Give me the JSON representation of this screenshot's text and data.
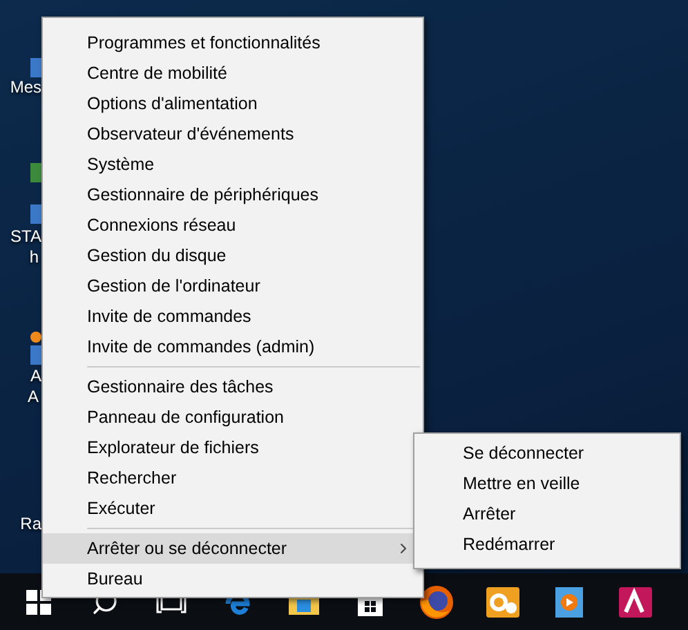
{
  "desktop_icons": [
    {
      "label_lines": [
        "Mes"
      ],
      "kind": "single"
    },
    {
      "label_lines": [
        "STA",
        "h"
      ],
      "kind": "double"
    },
    {
      "label_lines": [
        "A",
        "A"
      ],
      "kind": "dot"
    },
    {
      "label_lines": [
        "Ra"
      ],
      "kind": "none"
    }
  ],
  "context_menu": {
    "groups": [
      [
        {
          "label": "Programmes et fonctionnalités",
          "selected": false,
          "has_submenu": false
        },
        {
          "label": "Centre de mobilité",
          "selected": false,
          "has_submenu": false
        },
        {
          "label": "Options d'alimentation",
          "selected": false,
          "has_submenu": false
        },
        {
          "label": "Observateur d'événements",
          "selected": false,
          "has_submenu": false
        },
        {
          "label": "Système",
          "selected": false,
          "has_submenu": false
        },
        {
          "label": "Gestionnaire de périphériques",
          "selected": false,
          "has_submenu": false
        },
        {
          "label": "Connexions réseau",
          "selected": false,
          "has_submenu": false
        },
        {
          "label": "Gestion du disque",
          "selected": false,
          "has_submenu": false
        },
        {
          "label": "Gestion de l'ordinateur",
          "selected": false,
          "has_submenu": false
        },
        {
          "label": "Invite de commandes",
          "selected": false,
          "has_submenu": false
        },
        {
          "label": "Invite de commandes (admin)",
          "selected": false,
          "has_submenu": false
        }
      ],
      [
        {
          "label": "Gestionnaire des tâches",
          "selected": false,
          "has_submenu": false
        },
        {
          "label": "Panneau de configuration",
          "selected": false,
          "has_submenu": false
        },
        {
          "label": "Explorateur de fichiers",
          "selected": false,
          "has_submenu": false
        },
        {
          "label": "Rechercher",
          "selected": false,
          "has_submenu": false
        },
        {
          "label": "Exécuter",
          "selected": false,
          "has_submenu": false
        }
      ],
      [
        {
          "label": "Arrêter ou se déconnecter",
          "selected": true,
          "has_submenu": true
        },
        {
          "label": "Bureau",
          "selected": false,
          "has_submenu": false
        }
      ]
    ]
  },
  "submenu": {
    "items": [
      {
        "label": "Se déconnecter",
        "selected": false
      },
      {
        "label": "Mettre en veille",
        "selected": false
      },
      {
        "label": "Arrêter",
        "selected": false
      },
      {
        "label": "Redémarrer",
        "selected": false
      }
    ]
  }
}
